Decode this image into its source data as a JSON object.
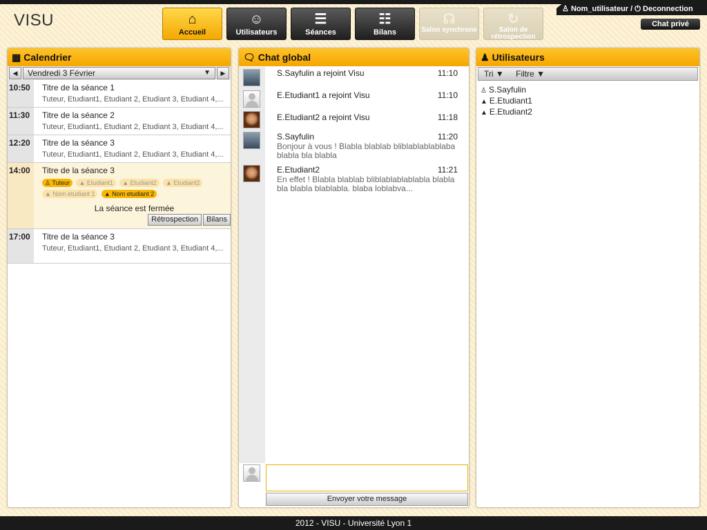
{
  "app": {
    "logo": "VISU"
  },
  "nav": [
    {
      "label": "Accueil",
      "icon": "home-icon",
      "glyph": "⌂"
    },
    {
      "label": "Utilisateurs",
      "icon": "users-icon",
      "glyph": "☺"
    },
    {
      "label": "Séances",
      "icon": "clipboard-icon",
      "glyph": "☰"
    },
    {
      "label": "Bilans",
      "icon": "report-icon",
      "glyph": "☷"
    },
    {
      "label": "Salon synchrone",
      "icon": "headset-icon",
      "glyph": "☊"
    },
    {
      "label": "Salon de rétrospection",
      "icon": "replay-icon",
      "glyph": "↻"
    }
  ],
  "userbar": {
    "username": "Nom_utilisateur",
    "separator": " / ",
    "logout": "Deconnection"
  },
  "chat_prive": "Chat privé",
  "calendar": {
    "title": "Calendrier",
    "date": "Vendredi 3 Février",
    "prev": "◀",
    "next": "▶",
    "sessions": [
      {
        "time": "10:50",
        "title": "Titre de la séance 1",
        "participants": "Tuteur, Etudiant1, Etudiant 2, Etudiant 3, Etudiant 4,..."
      },
      {
        "time": "11:30",
        "title": "Titre de la séance 2",
        "participants": "Tuteur, Etudiant1, Etudiant 2, Etudiant 3, Etudiant 4,..."
      },
      {
        "time": "12:20",
        "title": "Titre de la séance 3",
        "participants": "Tuteur, Etudiant1, Etudiant 2, Etudiant 3, Etudiant 4,..."
      },
      {
        "time": "14:00",
        "title": "Titre de la séance 3",
        "tags": [
          {
            "label": "Tuteur",
            "active": true
          },
          {
            "label": "Etudiant1",
            "active": false
          },
          {
            "label": "Etudiant2",
            "active": false
          },
          {
            "label": "Etudiant2",
            "active": false
          },
          {
            "label": "Nom etudiant 1",
            "active": false
          },
          {
            "label": "Nom etudiant 2",
            "active": true
          }
        ],
        "status": "La séance est fermée",
        "buttons": [
          "Rétrospection",
          "Bilans"
        ]
      },
      {
        "time": "17:00",
        "title": "Titre de la séance 3",
        "participants": "Tuteur, Etudiant1, Etudiant 2, Etudiant 3, Etudiant 4,..."
      }
    ]
  },
  "chat": {
    "title": "Chat global",
    "messages": [
      {
        "name": "S.Sayfulin a rejoint Visu",
        "time": "11:10",
        "text": "",
        "avatar": "m"
      },
      {
        "name": "E.Etudiant1 a rejoint Visu",
        "time": "11:10",
        "text": "",
        "avatar": "ph"
      },
      {
        "name": "E.Etudiant2 a rejoint Visu",
        "time": "11:18",
        "text": "",
        "avatar": "f"
      },
      {
        "name": "S.Sayfulin",
        "time": "11:20",
        "text": "Bonjour à vous ! Blabla blablab bliblablablablaba blabla bla blabla",
        "avatar": "m"
      },
      {
        "name": "E.Etudiant2",
        "time": "11:21",
        "text": "En effet ! Blabla blablab bliblablablablabla blabla bla blabla blablabla. blaba loblabva...",
        "avatar": "f"
      }
    ],
    "input_value": "",
    "send_label": "Envoyer votre message"
  },
  "users": {
    "title": "Utilisateurs",
    "sort": "Tri ▼",
    "filter": "Filtre ▼",
    "list": [
      {
        "name": "S.Sayfulin",
        "role": "tutor"
      },
      {
        "name": "E.Etudiant1",
        "role": "student"
      },
      {
        "name": "E.Etudiant2",
        "role": "student"
      }
    ]
  },
  "footer": "2012 - VISU - Université Lyon 1"
}
